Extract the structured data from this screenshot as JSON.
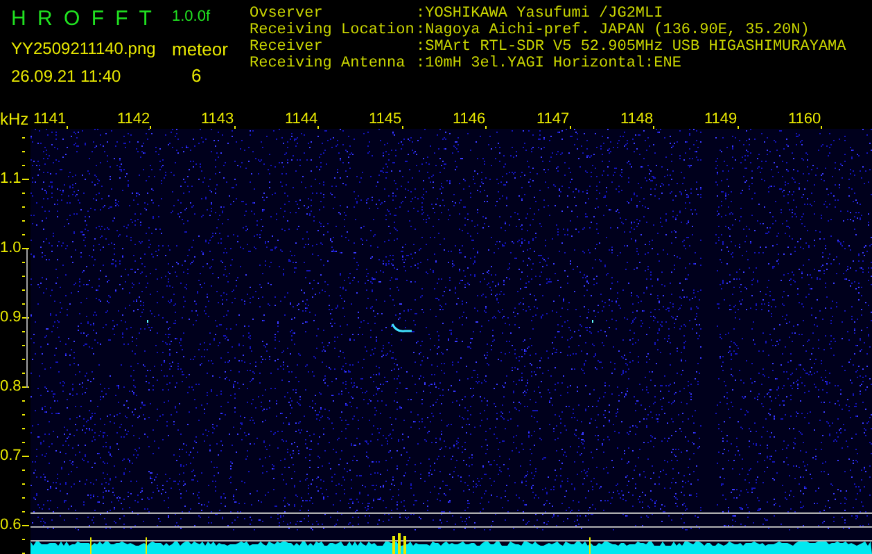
{
  "app": {
    "title": "H R O F F T",
    "version": "1.0.0f",
    "filename": "YY2509211140.png",
    "timestamp": "26.09.21 11:40",
    "event_label": "meteor",
    "event_count": "6"
  },
  "station_info": [
    {
      "label": "Ovserver",
      "value": ":YOSHIKAWA Yasufumi /JG2MLI"
    },
    {
      "label": "Receiving Location",
      "value": ":Nagoya Aichi-pref. JAPAN (136.90E, 35.20N)"
    },
    {
      "label": "Receiver",
      "value": ":SMArt RTL-SDR V5 52.905MHz USB HIGASHIMURAYAMA"
    },
    {
      "label": "Receiving Antenna",
      "value": ":10mH 3el.YAGI Horizontal:ENE"
    }
  ],
  "spectrogram": {
    "x_unit": "kHz",
    "x_labels": [
      "1141",
      "1142",
      "1143",
      "1144",
      "1145",
      "1146",
      "1147",
      "1148",
      "1149",
      "1160"
    ],
    "y_labels": [
      "1.1",
      "1.0",
      "0.9",
      "0.8",
      "0.7",
      "0.6"
    ]
  }
}
